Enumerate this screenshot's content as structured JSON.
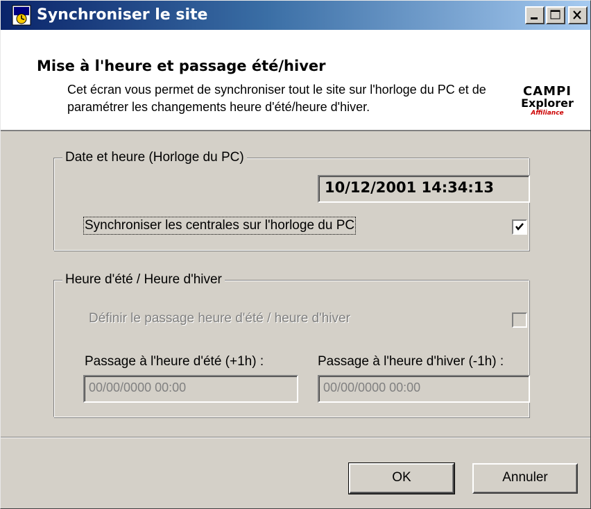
{
  "window": {
    "title": "Synchroniser le site",
    "controls": {
      "minimize": "minimize",
      "maximize": "maximize",
      "close": "close"
    }
  },
  "header": {
    "title": "Mise à l'heure et passage été/hiver",
    "description": "Cet écran vous permet de synchroniser tout le site sur l'horloge du PC et de paramétrer les changements heure d'été/heure d'hiver.",
    "logo": {
      "line1": "CAMPI",
      "line2": "Explorer",
      "line3": "Affiliance"
    }
  },
  "group_datetime": {
    "legend": "Date et heure (Horloge du PC)",
    "current_datetime": "10/12/2001 14:34:13",
    "sync_label": "Synchroniser les centrales sur l'horloge du PC",
    "sync_checked": true
  },
  "group_dst": {
    "legend": "Heure d'été / Heure d'hiver",
    "define_label": "Définir le passage heure d'été / heure d'hiver",
    "define_checked": false,
    "summer_label": "Passage à l'heure d'été (+1h) :",
    "summer_value": "00/00/0000 00:00",
    "winter_label": "Passage à l'heure d'hiver (-1h) :",
    "winter_value": "00/00/0000 00:00"
  },
  "buttons": {
    "ok": "OK",
    "cancel": "Annuler"
  },
  "colors": {
    "titlebar_start": "#0a246a",
    "titlebar_end": "#a6caf0",
    "face": "#d4d0c8",
    "logo_red": "#cc0000"
  }
}
